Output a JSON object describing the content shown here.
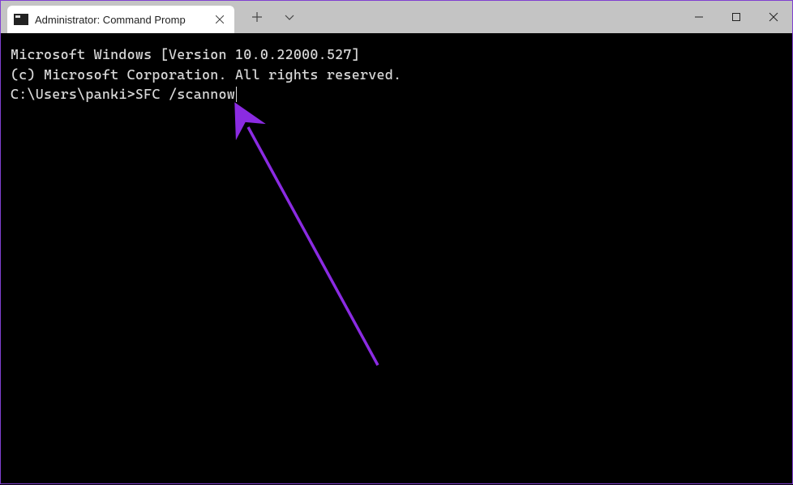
{
  "window": {
    "tab_title": "Administrator: Command Promp",
    "controls": {
      "minimize": "minimize",
      "maximize": "maximize",
      "close": "close"
    }
  },
  "terminal": {
    "line1": "Microsoft Windows [Version 10.0.22000.527]",
    "line2": "(c) Microsoft Corporation. All rights reserved.",
    "blank": "",
    "prompt": "C:\\Users\\panki>",
    "command": "SFC /scannow"
  },
  "annotation": {
    "arrow_color": "#8b2be2"
  }
}
